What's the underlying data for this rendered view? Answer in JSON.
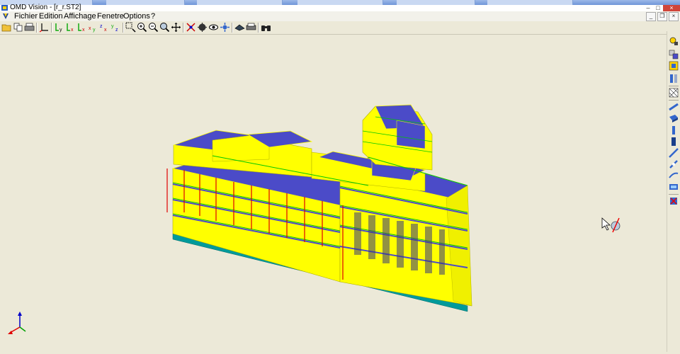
{
  "window": {
    "title": "OMD Vision - [r_r.ST2]"
  },
  "menu": {
    "items": [
      "Fichier",
      "Edition",
      "Affichage",
      "Fenetre",
      "Options",
      "?"
    ]
  },
  "toolbar": {
    "buttons": [
      "open-icon",
      "copy-icon",
      "print-icon",
      "axis-icon",
      "view-ly-icon",
      "view-lx-icon",
      "view-lxy-icon",
      "view-xy-icon",
      "view-zx-icon",
      "view-yz-icon",
      "zoom-window-icon",
      "zoom-in-icon",
      "zoom-out-icon",
      "zoom-extents-icon",
      "pan-icon",
      "rotate-icon",
      "eye-icon",
      "move-icon",
      "display-icon",
      "print-preview-icon",
      "binoculars-icon"
    ]
  },
  "side_toolbar": {
    "buttons": [
      "layers-icon",
      "materials-icon",
      "floor-icon",
      "walls-icon",
      "mesh-icon",
      "beam-icon",
      "slab-icon",
      "column-icon",
      "shell-icon",
      "link-icon",
      "brace-icon",
      "stair-icon",
      "support-icon",
      "delete-icon"
    ]
  },
  "colors": {
    "slab": "#4B4BC8",
    "wall": "#FFFF00",
    "beam": "#00C800",
    "column": "#E00000",
    "foundation": "#009A9A"
  }
}
